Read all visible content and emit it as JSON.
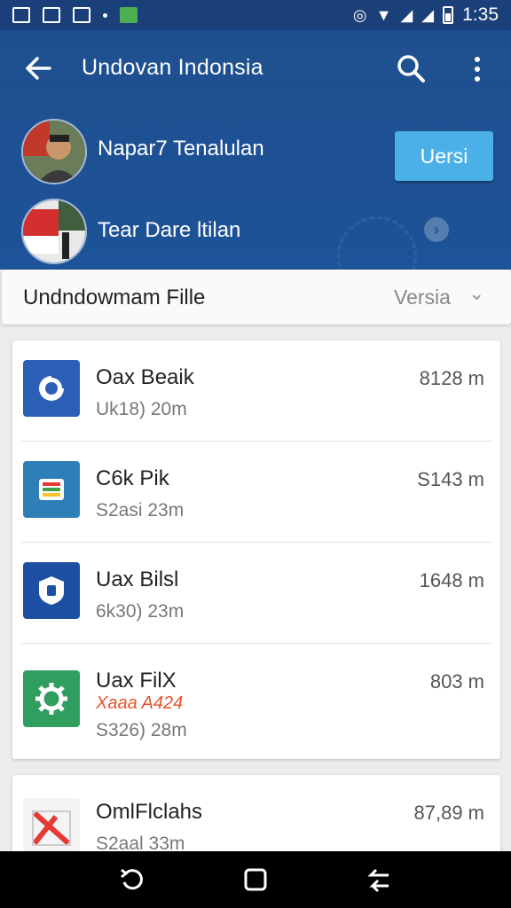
{
  "status_bar": {
    "time": "1:35"
  },
  "header": {
    "title": "Undovan Indonsia",
    "profiles": [
      {
        "name": "Napar7 Tenalulan"
      },
      {
        "name": "Tear Dare ltilan"
      }
    ],
    "version_button": "Uersi"
  },
  "filter": {
    "title": "Undndowmam Fille",
    "select_value": "Versia"
  },
  "items": [
    {
      "title": "Oax Beaik",
      "subtitle": "Uk18) 20m",
      "size": "8128 m",
      "icon": "refresh-circle-icon",
      "color": "#2b5fb5"
    },
    {
      "title": "C6k Pik",
      "subtitle": "S2asi 23m",
      "size": "S143 m",
      "icon": "box-stack-icon",
      "color": "#2e7fb8"
    },
    {
      "title": "Uax Bilsl",
      "subtitle": "6k30) 23m",
      "size": "1648 m",
      "icon": "shield-icon",
      "color": "#1d4fa3"
    },
    {
      "title": "Uax FilX",
      "badge": "Xaaa A424",
      "subtitle": "S326) 28m",
      "size": "803 m",
      "icon": "gear-icon",
      "color": "#2f9e5f"
    },
    {
      "title": "OmlFlclahs",
      "subtitle": "S2aal 33m",
      "size": "87,89 m",
      "icon": "mail-icon",
      "color": "#e53935"
    }
  ]
}
